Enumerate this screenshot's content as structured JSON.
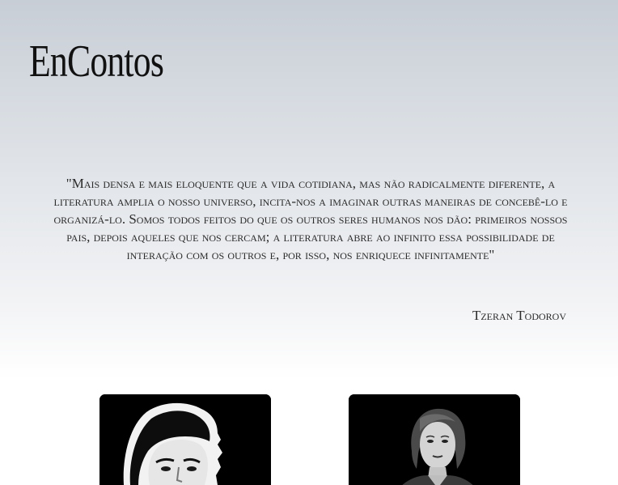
{
  "header": {
    "logo_text": "EnContos"
  },
  "epigraph": {
    "quote": "\"Mais densa e mais eloquente que a vida cotidiana, mas não radicalmente diferente, a literatura amplia o nosso universo, incita-nos a imaginar outras maneiras de concebê-lo e organizá-lo. Somos todos feitos do que os outros seres humanos nos dão: primeiros nossos pais, depois aqueles que nos cercam; a literatura abre ao infinito essa possibilidade de interação com os outros e, por isso, nos enriquece infinitamente\"",
    "author": "Tzeran Todorov"
  },
  "authors": [
    {
      "image": "author-portrait-man"
    },
    {
      "image": "author-portrait-woman"
    }
  ],
  "colors": {
    "text": "#2b2b2b",
    "logo": "#111111",
    "card_background": "#000000",
    "gradient_top": "#c8ced6",
    "gradient_bottom": "#ffffff"
  }
}
